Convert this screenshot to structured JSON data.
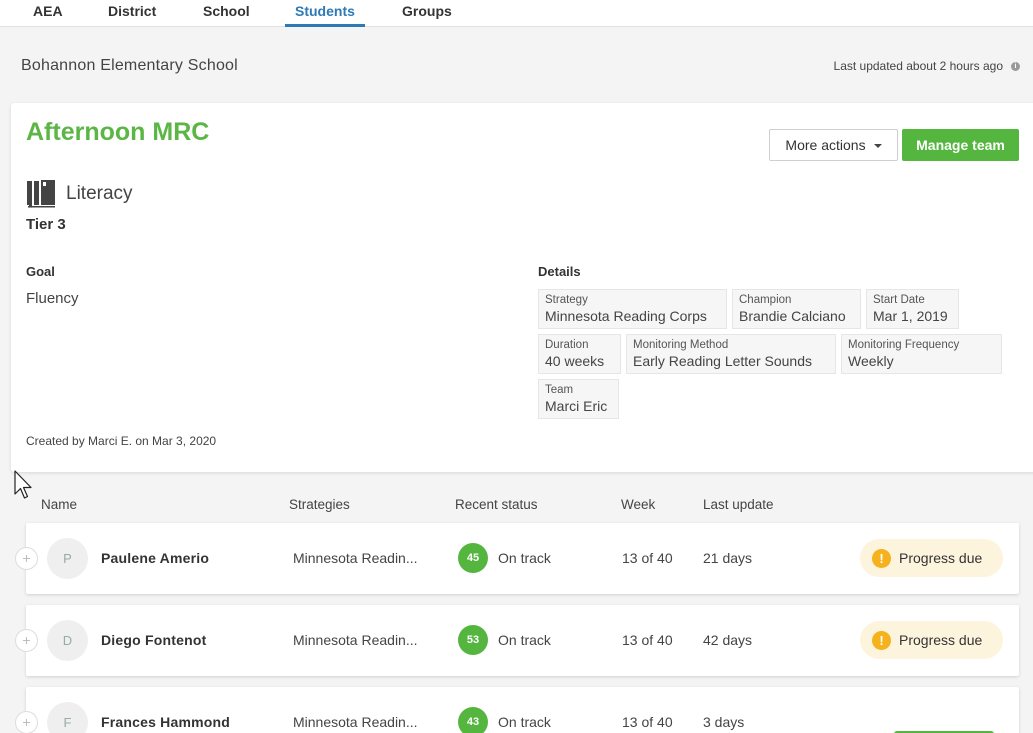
{
  "nav": {
    "tabs": [
      {
        "label": "AEA",
        "active": false
      },
      {
        "label": "District",
        "active": false
      },
      {
        "label": "School",
        "active": false
      },
      {
        "label": "Students",
        "active": true
      },
      {
        "label": "Groups",
        "active": false
      }
    ],
    "accent": "#2d7ab4"
  },
  "header": {
    "school_name": "Bohannon Elementary School",
    "last_updated": "Last updated about 2 hours ago",
    "info_icon": "info-icon"
  },
  "group": {
    "title": "Afternoon MRC",
    "title_color": "#5bb646",
    "more_actions_label": "More actions",
    "manage_team_label": "Manage team",
    "subject": "Literacy",
    "subject_icon": "book-icon",
    "tier": "Tier 3",
    "goal_label": "Goal",
    "goal_value": "Fluency",
    "details_label": "Details",
    "created_by": "Created by Marci E. on Mar 3, 2020",
    "details": [
      {
        "label": "Strategy",
        "value": "Minnesota Reading Corps"
      },
      {
        "label": "Champion",
        "value": "Brandie Calciano"
      },
      {
        "label": "Start Date",
        "value": "Mar 1, 2019"
      },
      {
        "label": "Duration",
        "value": "40 weeks"
      },
      {
        "label": "Monitoring Method",
        "value": "Early Reading Letter Sounds"
      },
      {
        "label": "Monitoring Frequency",
        "value": "Weekly"
      },
      {
        "label": "Team",
        "value": "Marci Eric"
      }
    ]
  },
  "table": {
    "columns": [
      "Name",
      "Strategies",
      "Recent status",
      "Week",
      "Last update"
    ],
    "rows": [
      {
        "initial": "P",
        "name": "Paulene Amerio",
        "strategy": "Minnesota Readin...",
        "score": "45",
        "status": "On track",
        "week": "13 of 40",
        "last_update": "21 days",
        "badge": "Progress due"
      },
      {
        "initial": "D",
        "name": "Diego Fontenot",
        "strategy": "Minnesota Readin...",
        "score": "53",
        "status": "On track",
        "week": "13 of 40",
        "last_update": "42 days",
        "badge": "Progress due"
      },
      {
        "initial": "F",
        "name": "Frances Hammond",
        "strategy": "Minnesota Readin...",
        "score": "43",
        "status": "On track",
        "week": "13 of 40",
        "last_update": "3 days",
        "badge": ""
      }
    ],
    "expand_glyph": "+",
    "warn_glyph": "!",
    "status_color": "#55b63f",
    "badge_color": "#fdf4dd"
  }
}
